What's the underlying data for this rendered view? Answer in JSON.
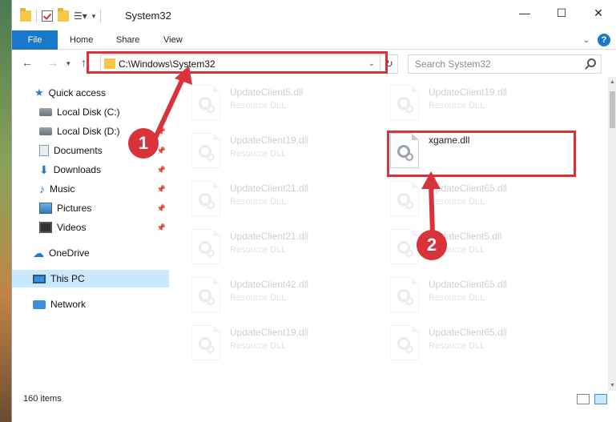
{
  "window": {
    "title": "System32"
  },
  "ribbon": {
    "tabs": [
      "File",
      "Home",
      "Share",
      "View"
    ]
  },
  "address": {
    "path": "C:\\Windows\\System32",
    "search_placeholder": "Search System32"
  },
  "nav": {
    "items": [
      {
        "label": "Quick access",
        "icon": "star-icon"
      },
      {
        "label": "Local Disk (C:)",
        "icon": "disk-icon"
      },
      {
        "label": "Local Disk (D:)",
        "icon": "disk-icon"
      },
      {
        "label": "Documents",
        "icon": "document-icon"
      },
      {
        "label": "Downloads",
        "icon": "download-icon"
      },
      {
        "label": "Music",
        "icon": "music-icon"
      },
      {
        "label": "Pictures",
        "icon": "pictures-icon"
      },
      {
        "label": "Videos",
        "icon": "videos-icon"
      },
      {
        "label": "OneDrive",
        "icon": "cloud-icon"
      },
      {
        "label": "This PC",
        "icon": "computer-icon"
      },
      {
        "label": "Network",
        "icon": "network-icon"
      }
    ]
  },
  "files": {
    "col1": [
      {
        "name": "UpdateClient5.dll",
        "type": "Resource DLL"
      },
      {
        "name": "UpdateClient19.dll",
        "type": "Resource DLL"
      },
      {
        "name": "UpdateClient21.dll",
        "type": "Resource DLL"
      },
      {
        "name": "UpdateClient21.dll",
        "type": "Resource DLL"
      },
      {
        "name": "UpdateClient42.dll",
        "type": "Resource DLL"
      },
      {
        "name": "UpdateClient19.dll",
        "type": "Resource DLL"
      }
    ],
    "col2": [
      {
        "name": "UpdateClient19.dll",
        "type": "Resource DLL"
      },
      {
        "name": "xgame.dll",
        "type": ""
      },
      {
        "name": "UpdateClient65.dll",
        "type": "Resource DLL"
      },
      {
        "name": "UpdateClient5.dll",
        "type": "Resource DLL"
      },
      {
        "name": "UpdateClient65.dll",
        "type": "Resource DLL"
      },
      {
        "name": "UpdateClient65.dll",
        "type": "Resource DLL"
      }
    ]
  },
  "status": {
    "items_count": "160 items"
  },
  "annotations": {
    "step1": "1",
    "step2": "2",
    "color": "#d9323a"
  }
}
